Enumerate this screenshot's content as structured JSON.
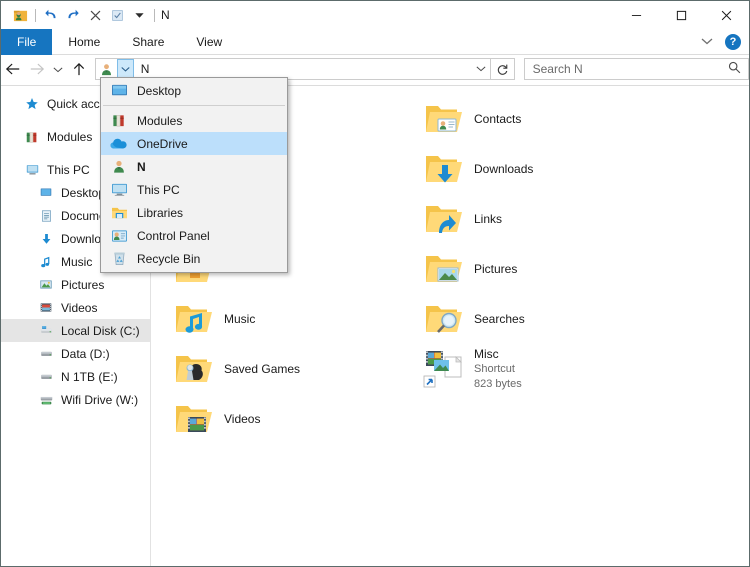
{
  "window": {
    "title": "N",
    "quick_access_toolbar": [
      {
        "name": "folder-properties-icon",
        "glyph": "user-folder"
      },
      {
        "name": "undo-icon",
        "glyph": "↶"
      },
      {
        "name": "redo-icon",
        "glyph": "↷"
      },
      {
        "name": "delete-icon",
        "glyph": "✕"
      },
      {
        "name": "properties-icon",
        "glyph": "checkbox"
      },
      {
        "name": "customize-qat-icon",
        "glyph": "▾"
      }
    ],
    "controls": {
      "minimize": "—",
      "maximize": "□",
      "close": "✕"
    }
  },
  "ribbon": {
    "tabs": [
      {
        "label": "File",
        "active": true
      },
      {
        "label": "Home",
        "active": false
      },
      {
        "label": "Share",
        "active": false
      },
      {
        "label": "View",
        "active": false
      }
    ],
    "collapse_icon": "⌄",
    "help_label": "?"
  },
  "addressbar": {
    "back_icon": "←",
    "forward_icon": "→",
    "recent_icon": "⌄",
    "up_icon": "↑",
    "location_icon": "user-icon",
    "breadcrumb_chevron": "⌄",
    "path_text": "N",
    "path_dropdown_icon": "⌄",
    "refresh_icon": "↻"
  },
  "search": {
    "placeholder": "Search N",
    "icon": "search-icon"
  },
  "path_menu": {
    "items": [
      {
        "label": "Desktop",
        "icon": "desktop-icon",
        "highlight": false,
        "bold": false
      },
      {
        "separator": true
      },
      {
        "label": "Modules",
        "icon": "books-icon",
        "highlight": false,
        "bold": false
      },
      {
        "label": "OneDrive",
        "icon": "onedrive-cloud-icon",
        "highlight": true,
        "bold": false
      },
      {
        "label": "N",
        "icon": "user-icon",
        "highlight": false,
        "bold": true
      },
      {
        "label": "This PC",
        "icon": "this-pc-icon",
        "highlight": false,
        "bold": false
      },
      {
        "label": "Libraries",
        "icon": "libraries-folder-icon",
        "highlight": false,
        "bold": false
      },
      {
        "label": "Control Panel",
        "icon": "control-panel-icon",
        "highlight": false,
        "bold": false
      },
      {
        "label": "Recycle Bin",
        "icon": "recycle-bin-icon",
        "highlight": false,
        "bold": false
      }
    ]
  },
  "sidebar": {
    "items": [
      {
        "label": "Quick access",
        "icon": "star-icon",
        "indent": false,
        "selected": false
      },
      {
        "label": "Modules",
        "icon": "books-icon",
        "indent": false,
        "selected": false,
        "gap_before": true
      },
      {
        "label": "This PC",
        "icon": "this-pc-icon",
        "indent": false,
        "selected": false,
        "gap_before": true
      },
      {
        "label": "Desktop",
        "icon": "desktop-icon",
        "indent": true,
        "selected": false
      },
      {
        "label": "Documents",
        "icon": "documents-icon",
        "indent": true,
        "selected": false
      },
      {
        "label": "Downloads",
        "icon": "downloads-arrow-icon",
        "indent": true,
        "selected": false
      },
      {
        "label": "Music",
        "icon": "music-note-icon",
        "indent": true,
        "selected": false
      },
      {
        "label": "Pictures",
        "icon": "pictures-icon",
        "indent": true,
        "selected": false
      },
      {
        "label": "Videos",
        "icon": "videos-film-icon",
        "indent": true,
        "selected": false
      },
      {
        "label": "Local Disk (C:)",
        "icon": "system-drive-icon",
        "indent": true,
        "selected": true
      },
      {
        "label": "Data (D:)",
        "icon": "drive-icon",
        "indent": true,
        "selected": false
      },
      {
        "label": "N      1TB (E:)",
        "icon": "drive-icon",
        "indent": true,
        "selected": false
      },
      {
        "label": "Wifi Drive (W:)",
        "icon": "network-drive-icon",
        "indent": true,
        "selected": false
      }
    ]
  },
  "files": {
    "items": [
      {
        "name": "",
        "icon": "folder-blank-icon",
        "hidden_behind_menu": true
      },
      {
        "name": "Contacts",
        "icon": "folder-contacts-icon"
      },
      {
        "name": "",
        "icon": "folder-blank-icon",
        "hidden_behind_menu": true
      },
      {
        "name": "Downloads",
        "icon": "folder-downloads-icon"
      },
      {
        "name": "",
        "icon": "folder-blank-icon",
        "hidden_behind_menu": true
      },
      {
        "name": "Links",
        "icon": "folder-links-icon"
      },
      {
        "name": "",
        "icon": "folder-documents-icon",
        "hidden_behind_menu": true
      },
      {
        "name": "Pictures",
        "icon": "folder-pictures-icon"
      },
      {
        "name": "Music",
        "icon": "folder-music-icon"
      },
      {
        "name": "Searches",
        "icon": "folder-searches-icon"
      },
      {
        "name": "Saved Games",
        "icon": "folder-savedgames-icon"
      },
      {
        "name": "Misc",
        "icon": "shortcut-file-icon",
        "subtitle": "Shortcut",
        "size": "823 bytes"
      },
      {
        "name": "Videos",
        "icon": "folder-videos-icon"
      }
    ]
  },
  "colors": {
    "accent": "#1675c0",
    "highlight": "#bcdffb",
    "selection": "#e5e5e5",
    "folder": "#ffd264",
    "menu_bg": "#f2f2f2"
  }
}
